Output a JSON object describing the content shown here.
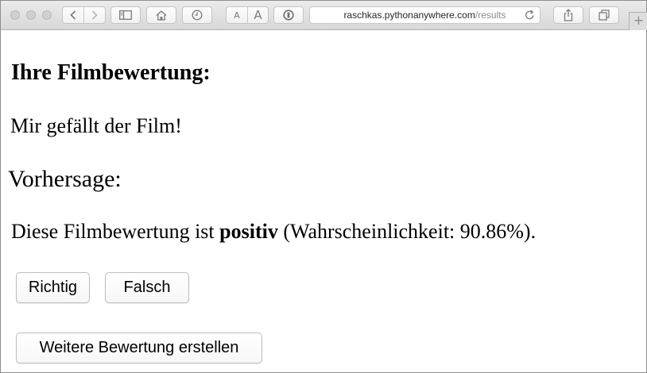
{
  "browser": {
    "url_host": "raschkas.pythonanywhere.com",
    "url_path": "/results",
    "font_smaller": "A",
    "font_larger": "A",
    "new_tab_label": "+"
  },
  "page": {
    "title": "Ihre Filmbewertung:",
    "review_text": "Mir gefällt der Film!",
    "prediction_label": "Vorhersage:",
    "prediction_prefix": "Diese Filmbewertung ist ",
    "prediction_class": "positiv",
    "prediction_suffix": " (Wahrscheinlichkeit: 90.86%).",
    "buttons": {
      "correct": "Richtig",
      "wrong": "Falsch",
      "new_review": "Weitere Bewertung erstellen"
    }
  },
  "icons": [
    "back-icon",
    "forward-icon",
    "sidebar-icon",
    "home-icon",
    "history-icon",
    "reader-icon",
    "reload-icon",
    "share-icon",
    "tabs-icon"
  ]
}
